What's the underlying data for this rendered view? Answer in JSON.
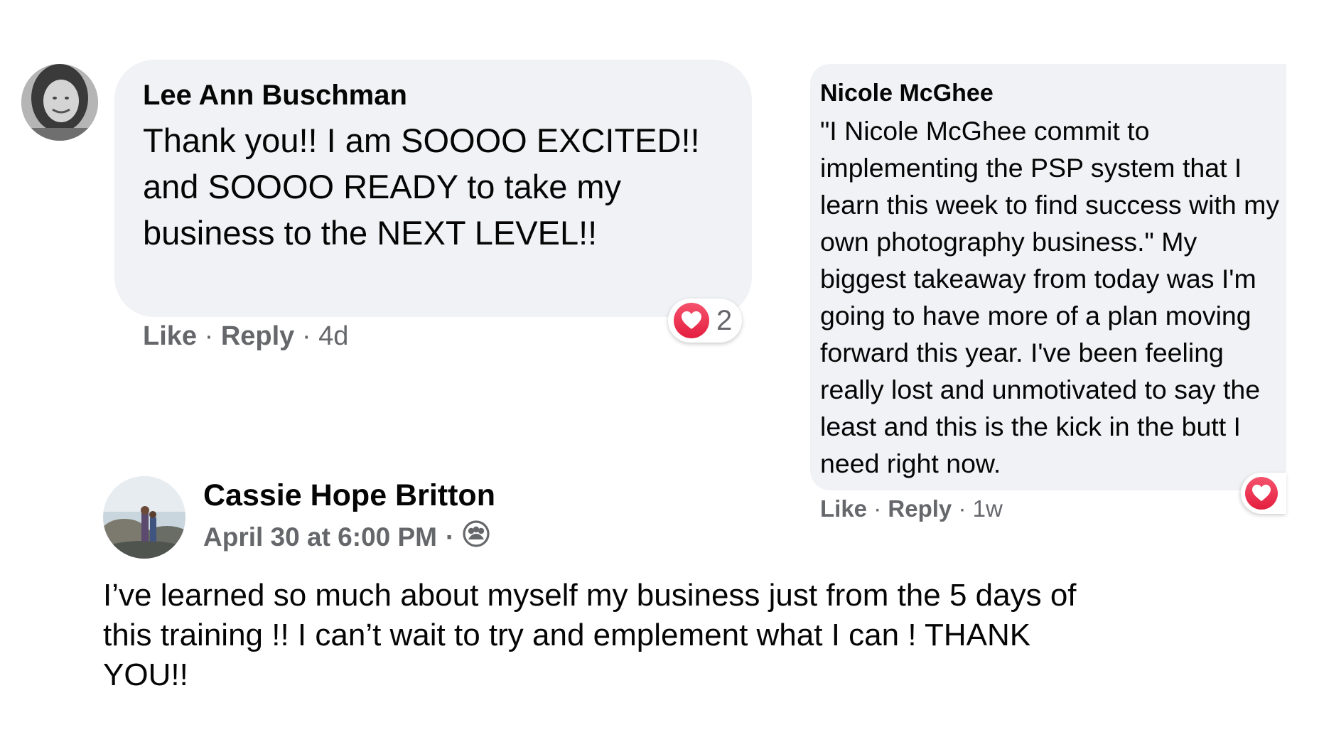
{
  "comment1": {
    "author": "Lee Ann Buschman",
    "text": "Thank you!! I am SOOOO EXCITED!! and SOOOO READY to take my business to the NEXT LEVEL!!",
    "like_label": "Like",
    "reply_label": "Reply",
    "separator": "·",
    "time": "4d",
    "reaction_icon": "heart-icon",
    "reaction_count": "2",
    "reaction_color": "#e41e3f"
  },
  "comment2": {
    "author": "Nicole McGhee",
    "text": "\"I Nicole McGhee commit to implementing the PSP system that I learn this week to find success with my own photography business.\" My biggest takeaway from today was I'm going to have more of a plan moving forward this year. I've been feeling really lost and unmotivated to say the least and this is the kick in the butt I need right now.",
    "like_label": "Like",
    "reply_label": "Reply",
    "separator": "·",
    "time": "1w",
    "reaction_icon": "heart-icon"
  },
  "post": {
    "author": "Cassie Hope Britton",
    "timestamp": "April 30 at 6:00 PM",
    "separator": "·",
    "audience_icon": "group-icon",
    "text": "I’ve learned so much about myself my business just from the 5 days of this training !! I can’t wait to try and emplement what I can ! THANK YOU!!"
  },
  "colors": {
    "bubble_bg": "#f0f2f5",
    "secondary_text": "#65676b",
    "primary_text": "#050505"
  }
}
